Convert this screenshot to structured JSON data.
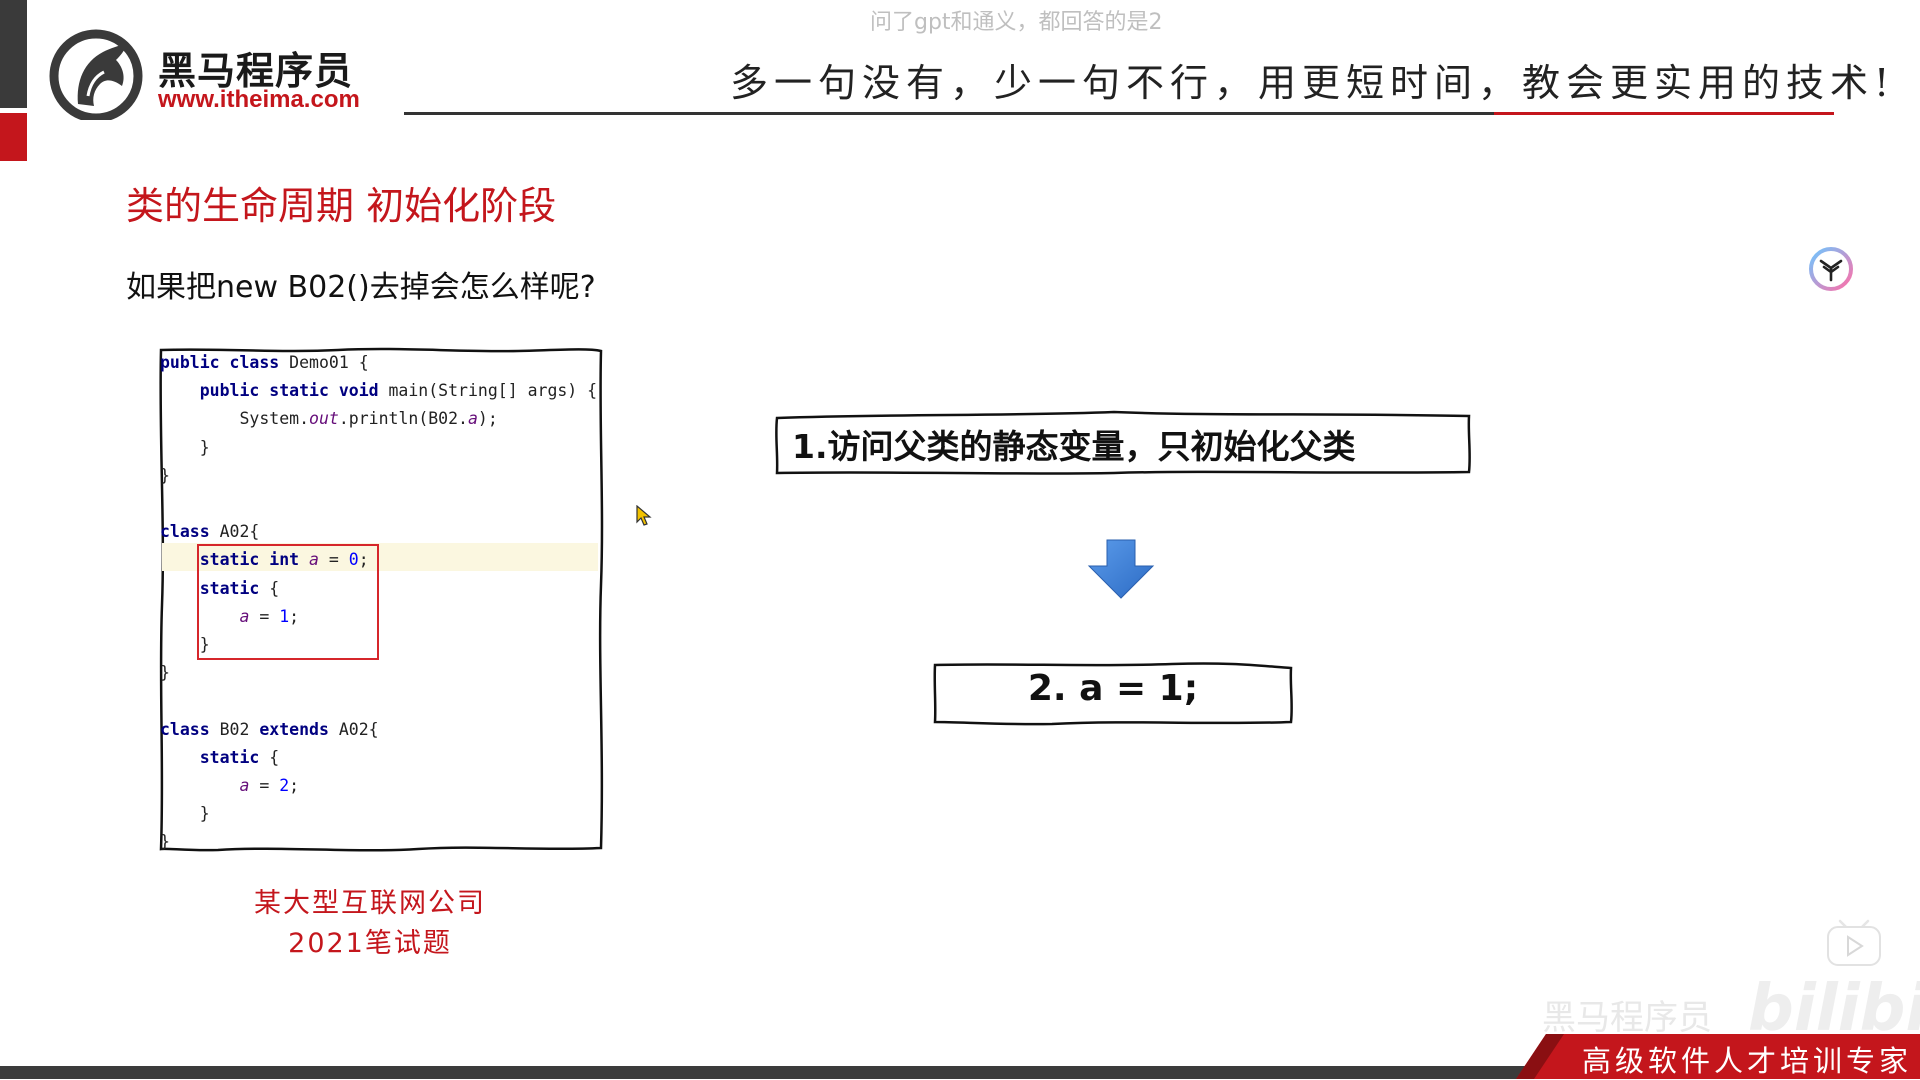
{
  "header": {
    "brand_name": "黑马程序员",
    "brand_url": "www.itheima.com",
    "slogan": "多一句没有，少一句不行，用更短时间，教会更实用的技术!"
  },
  "overlay": {
    "text": "问了gpt和通义，都回答的是2"
  },
  "slide": {
    "title": "类的生命周期 初始化阶段",
    "question": "如果把new B02()去掉会怎么样呢?",
    "caption_line1": "某大型互联网公司",
    "caption_line2": "2021笔试题",
    "step1": "1.访问父类的静态变量，只初始化父类",
    "step2": "2. a = 1;"
  },
  "code": {
    "l1_kw": "public class",
    "l1_rest": " Demo01 {",
    "l2_kw": "public static void",
    "l2_rest": " main(String[] args) {",
    "l3_a": "System.",
    "l3_field": "out",
    "l3_b": ".println(B02.",
    "l3_field2": "a",
    "l3_c": ");",
    "l4": "}",
    "l5": "}",
    "l7_kw": "class",
    "l7_rest": " A02{",
    "l8_kw": "static int",
    "l8_field": "a",
    "l8_eq": " = ",
    "l8_num": "0",
    "l8_end": ";",
    "l9_kw": "static",
    "l9_rest": " {",
    "l10_field": "a",
    "l10_eq": " = ",
    "l10_num": "1",
    "l10_end": ";",
    "l11": "}",
    "l12": "}",
    "l14_kw": "class",
    "l14_mid": " B02 ",
    "l14_kw2": "extends",
    "l14_rest": " A02{",
    "l15_kw": "static",
    "l15_rest": " {",
    "l16_field": "a",
    "l16_eq": " = ",
    "l16_num": "2",
    "l16_end": ";",
    "l17": "}",
    "l18": "}"
  },
  "watermark": {
    "text1": "黑马程序员",
    "text2": "bilibili"
  },
  "footer": {
    "tagline": "高级软件人才培训专家"
  },
  "colors": {
    "accent_red": "#c4161c",
    "arrow_blue": "#3d7fd6",
    "keyword_navy": "#000080",
    "field_purple": "#660e7a"
  },
  "icons": {
    "logo": "horse-head-logo-icon",
    "arrow": "arrow-down-icon",
    "circle": "brand-circle-icon",
    "play": "play-icon",
    "cursor": "mouse-cursor-icon"
  }
}
